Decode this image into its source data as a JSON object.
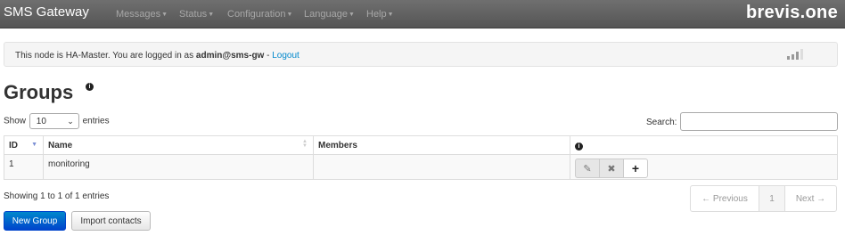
{
  "navbar": {
    "brand": "SMS Gateway",
    "menus": [
      {
        "label": "Messages"
      },
      {
        "label": "Status"
      },
      {
        "label": "Configuration"
      },
      {
        "label": "Language"
      },
      {
        "label": "Help"
      }
    ],
    "logo": "brevis.one"
  },
  "info_bar": {
    "text_prefix": "This node is HA-Master. You are logged in as ",
    "user": "admin@sms-gw",
    "separator": " - ",
    "logout_link": "Logout",
    "icon": "signal-bars-icon"
  },
  "page": {
    "title": "Groups",
    "title_icon": "info-icon"
  },
  "table_controls": {
    "show_label": "Show",
    "entries_select_value": "10",
    "entries_label": "entries",
    "search_label": "Search:",
    "search_value": ""
  },
  "table": {
    "columns": [
      "ID",
      "Name",
      "Members"
    ],
    "actions_header_icon": "info-icon",
    "rows": [
      {
        "id": "1",
        "name": "monitoring",
        "members": "",
        "actions": [
          "edit-icon",
          "delete-icon",
          "add-icon"
        ]
      }
    ]
  },
  "footer": {
    "info": "Showing 1 to 1 of 1 entries",
    "pagination": {
      "previous": "← Previous",
      "page": "1",
      "next": "Next →"
    }
  },
  "buttons": {
    "new_group": "New Group",
    "import_contacts": "Import contacts"
  },
  "colors": {
    "navbar": "#555555",
    "primary": "#0055cc",
    "link": "#0088cc"
  }
}
